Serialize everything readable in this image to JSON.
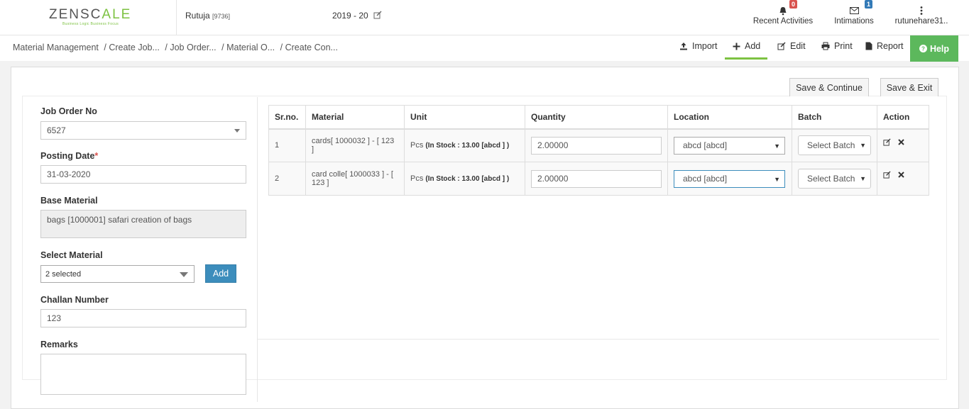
{
  "header": {
    "logo_main": "ZENSCALE",
    "logo_prefix": "ZENSC",
    "logo_accent": "ALE",
    "logo_tagline": "Business Logic Business Focus",
    "user_name": "Rutuja",
    "user_code": "[9736]",
    "fiscal_year": "2019 - 20",
    "recent_activities": {
      "label": "Recent Activities",
      "count": "0"
    },
    "intimations": {
      "label": "Intimations",
      "count": "1"
    },
    "account": {
      "label": "rutunehare31.."
    }
  },
  "breadcrumb": {
    "items": [
      "Material Management",
      "/ Create Job...",
      "/ Job Order...",
      "/ Material O...",
      "/ Create Con..."
    ]
  },
  "toolbar": {
    "import_label": "Import",
    "add_label": "Add",
    "edit_label": "Edit",
    "print_label": "Print",
    "report_label": "Report",
    "help_label": "Help"
  },
  "actions": {
    "save_continue": "Save & Continue",
    "save_exit": "Save & Exit"
  },
  "form": {
    "job_order_label": "Job Order No",
    "job_order_value": "6527",
    "posting_date_label": "Posting Date",
    "posting_date_required": "*",
    "posting_date_value": "31-03-2020",
    "base_material_label": "Base Material",
    "base_material_value": "bags [1000001] safari creation of bags",
    "select_material_label": "Select Material",
    "select_material_value": "2 selected",
    "add_button": "Add",
    "challan_label": "Challan Number",
    "challan_value": "123",
    "remarks_label": "Remarks",
    "remarks_value": ""
  },
  "table": {
    "headers": {
      "srno": "Sr.no.",
      "material": "Material",
      "unit": "Unit",
      "quantity": "Quantity",
      "location": "Location",
      "batch": "Batch",
      "action": "Action"
    },
    "rows": [
      {
        "srno": "1",
        "material": "cards[ 1000032 ] - [ 123 ]",
        "unit": "Pcs",
        "stock": "(In Stock : 13.00 [abcd ] )",
        "quantity": "2.00000",
        "location": "abcd [abcd]",
        "batch": "Select Batch"
      },
      {
        "srno": "2",
        "material": "card colle[ 1000033 ] - [ 123 ]",
        "unit": "Pcs",
        "stock": "(In Stock : 13.00 [abcd ] )",
        "quantity": "2.00000",
        "location": "abcd [abcd]",
        "batch": "Select Batch"
      }
    ]
  },
  "colors": {
    "brand_green": "#7dc242",
    "help_green": "#5cb85c",
    "primary_blue": "#3c8dbc",
    "badge_red": "#d9534f",
    "badge_blue": "#337ab7"
  },
  "icons": {
    "fiscal_edit": "edit-icon",
    "recent": "bell-icon",
    "intimations": "envelope-icon",
    "account": "vertical-dots-icon",
    "import": "upload-icon",
    "add": "plus-icon",
    "edit": "edit-icon",
    "print": "printer-icon",
    "report": "file-icon",
    "help": "question-circle-icon",
    "row_edit": "edit-icon",
    "row_delete": "close-icon"
  }
}
